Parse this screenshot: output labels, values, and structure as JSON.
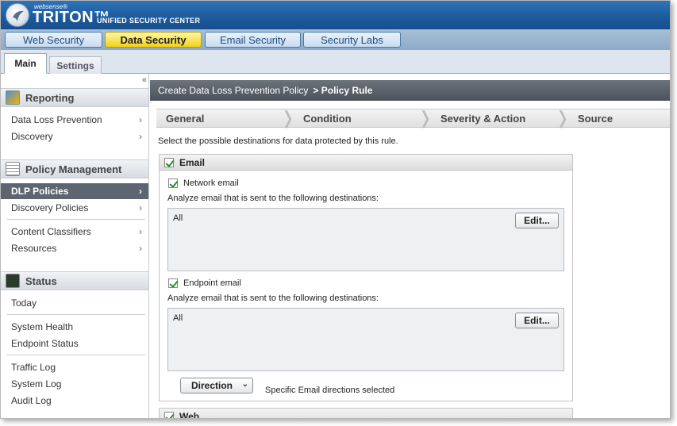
{
  "header": {
    "brand_small": "websense®",
    "brand_big": "TRITON™",
    "brand_sub": "UNIFIED SECURITY CENTER"
  },
  "modules": [
    {
      "label": "Web Security"
    },
    {
      "label": "Data Security",
      "active": true
    },
    {
      "label": "Email Security"
    },
    {
      "label": "Security Labs"
    }
  ],
  "subtabs": {
    "main": "Main",
    "settings": "Settings"
  },
  "sidebar": {
    "collapse_icon": "double-chevron-left-icon",
    "sections": {
      "reporting": "Reporting",
      "policy": "Policy Management",
      "status": "Status"
    },
    "reporting_items": [
      "Data Loss Prevention",
      "Discovery"
    ],
    "policy_items": [
      "DLP Policies",
      "Discovery Policies",
      "Content Classifiers",
      "Resources"
    ],
    "status_items": [
      "Today",
      "System Health",
      "Endpoint Status",
      "Traffic Log",
      "System Log",
      "Audit Log"
    ]
  },
  "breadcrumb": {
    "parent": "Create Data Loss Prevention Policy",
    "current": "> Policy Rule"
  },
  "steps": [
    "General",
    "Condition",
    "Severity & Action",
    "Source"
  ],
  "intro": "Select the possible destinations for data protected by this rule.",
  "email_group": {
    "title": "Email",
    "network": {
      "label": "Network email",
      "desc": "Analyze email that is sent to the following destinations:",
      "value": "All",
      "edit": "Edit..."
    },
    "endpoint": {
      "label": "Endpoint email",
      "desc": "Analyze email that is sent to the following destinations:",
      "value": "All",
      "edit": "Edit..."
    },
    "direction_button": "Direction",
    "direction_text": "Specific Email directions selected"
  },
  "web_group": {
    "title": "Web"
  },
  "colors": {
    "active_module": "#f2d21a",
    "header_blue": "#1b5a9c",
    "active_nav": "#5d6670"
  }
}
